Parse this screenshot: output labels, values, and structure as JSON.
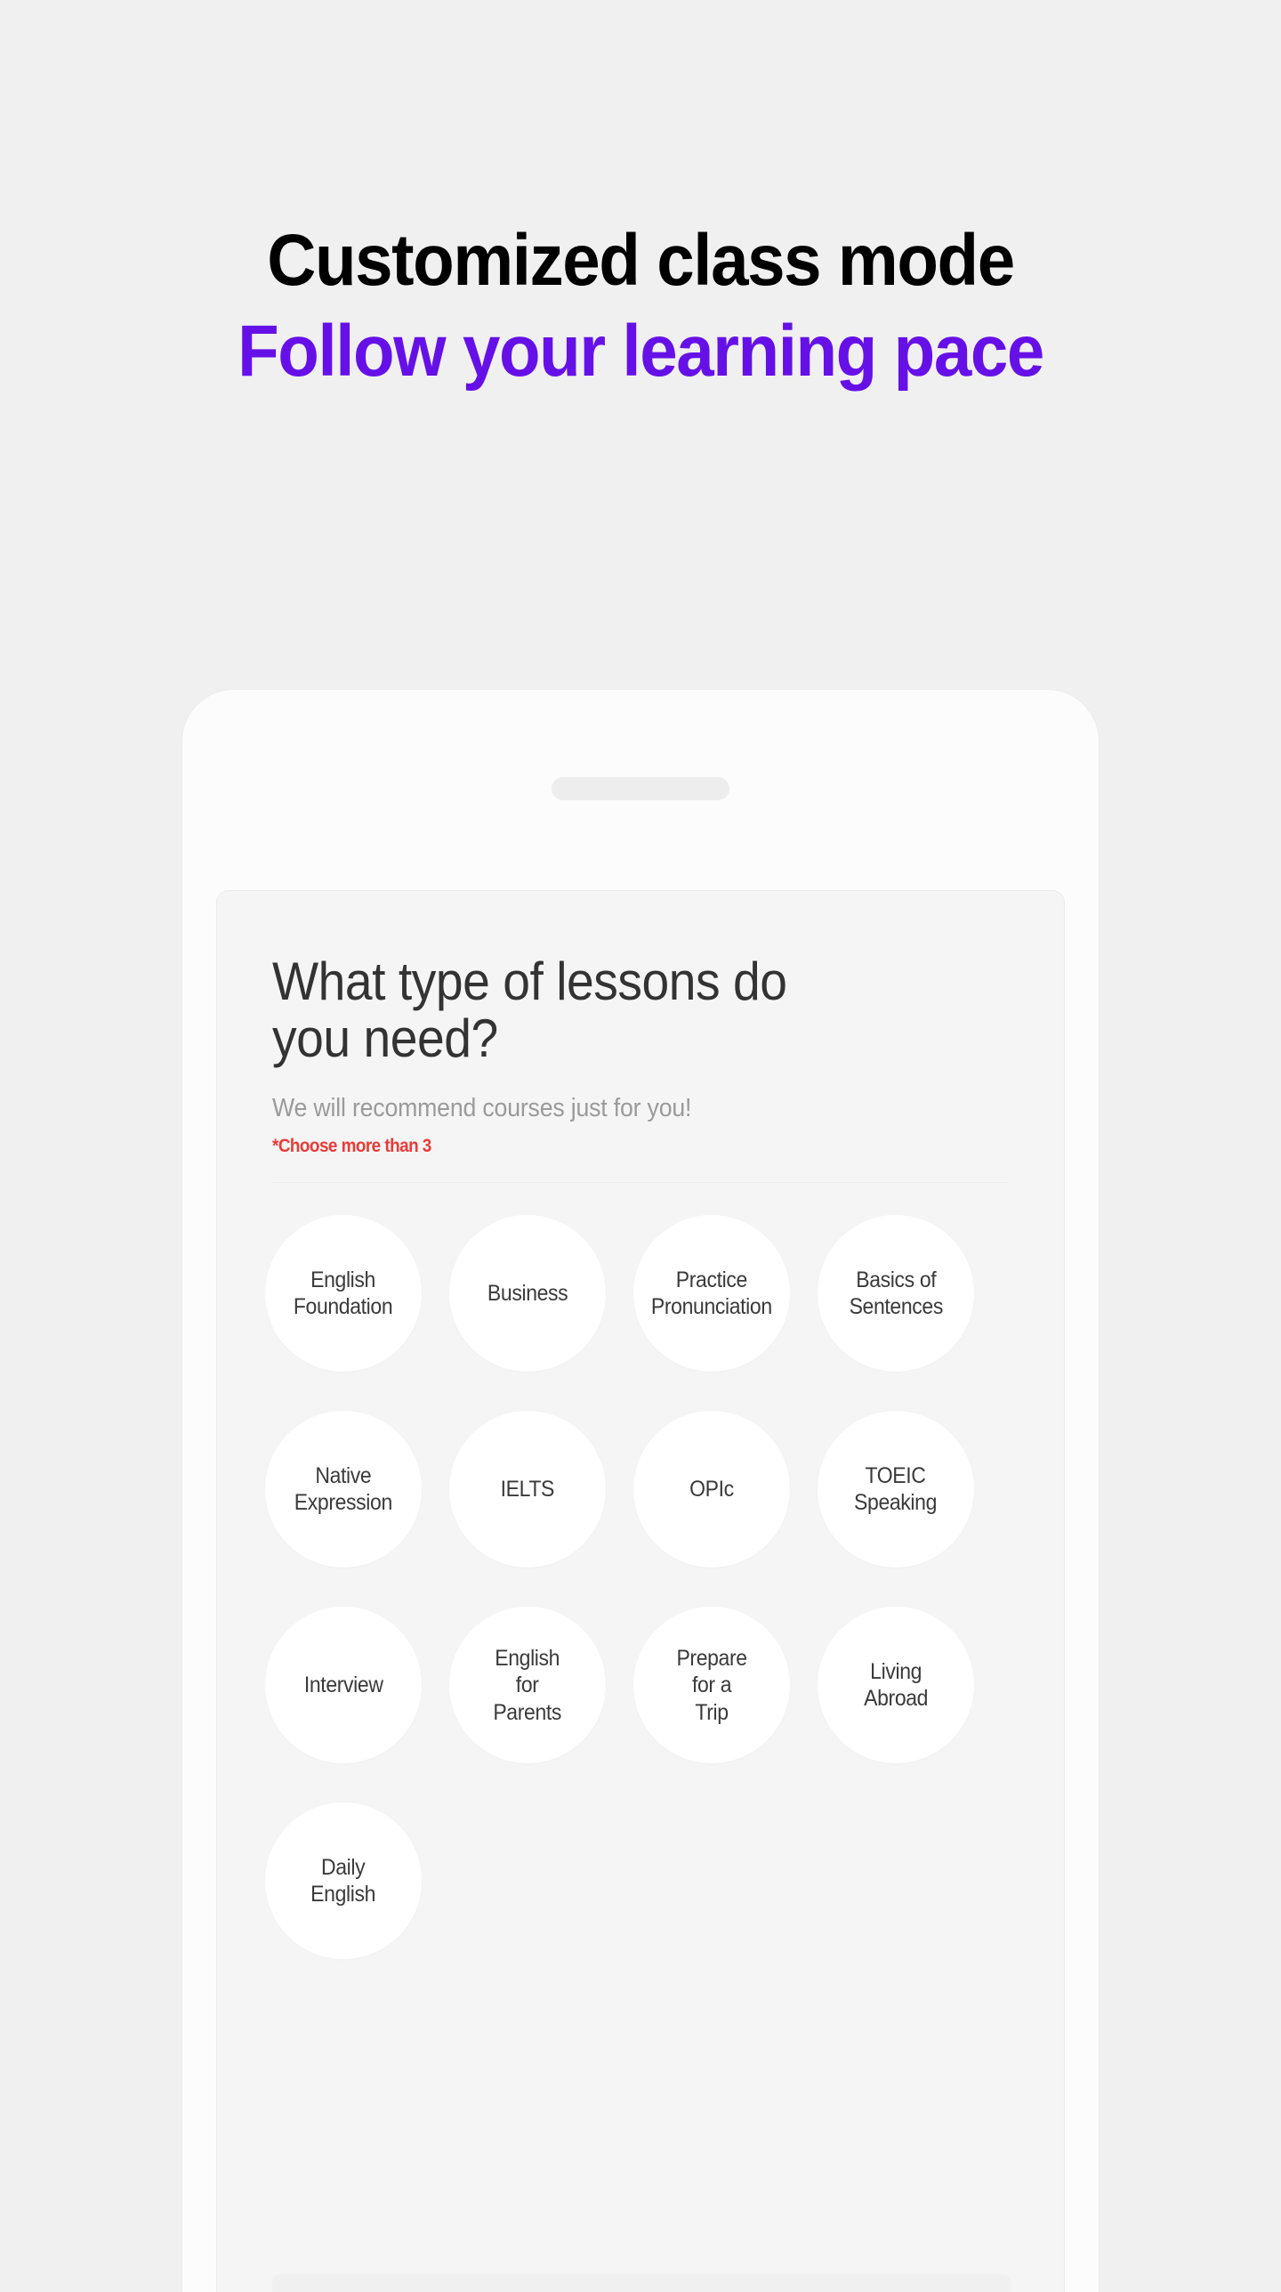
{
  "headline": {
    "line1": "Customized class mode",
    "line2": "Follow your learning pace",
    "accent_color": "#6610e8",
    "primary_color": "#000000"
  },
  "page": {
    "background_color": "#f0f0f0"
  },
  "phone": {
    "speaker_label": "speaker-grille",
    "frame_color": "#fcfcfc"
  },
  "screen": {
    "card_background": "#f5f5f5",
    "title": "What type of lessons do\nyou need?",
    "subtitle": "We will recommend courses just for you!",
    "note": "*Choose more than 3",
    "note_color": "#ea3b38",
    "chips": [
      {
        "label": "English\nFoundation",
        "selected": false
      },
      {
        "label": "Business",
        "selected": false
      },
      {
        "label": "Practice\nPronunciation",
        "selected": false
      },
      {
        "label": "Basics of\nSentences",
        "selected": false
      },
      {
        "label": "Native\nExpression",
        "selected": false
      },
      {
        "label": "IELTS",
        "selected": false
      },
      {
        "label": "OPIc",
        "selected": false
      },
      {
        "label": "TOEIC\nSpeaking",
        "selected": false
      },
      {
        "label": "Interview",
        "selected": false
      },
      {
        "label": "English\nfor\nParents",
        "selected": false
      },
      {
        "label": "Prepare\nfor a\nTrip",
        "selected": false
      },
      {
        "label": "Living\nAbroad",
        "selected": false
      },
      {
        "label": "Daily\nEnglish",
        "selected": false
      }
    ]
  }
}
